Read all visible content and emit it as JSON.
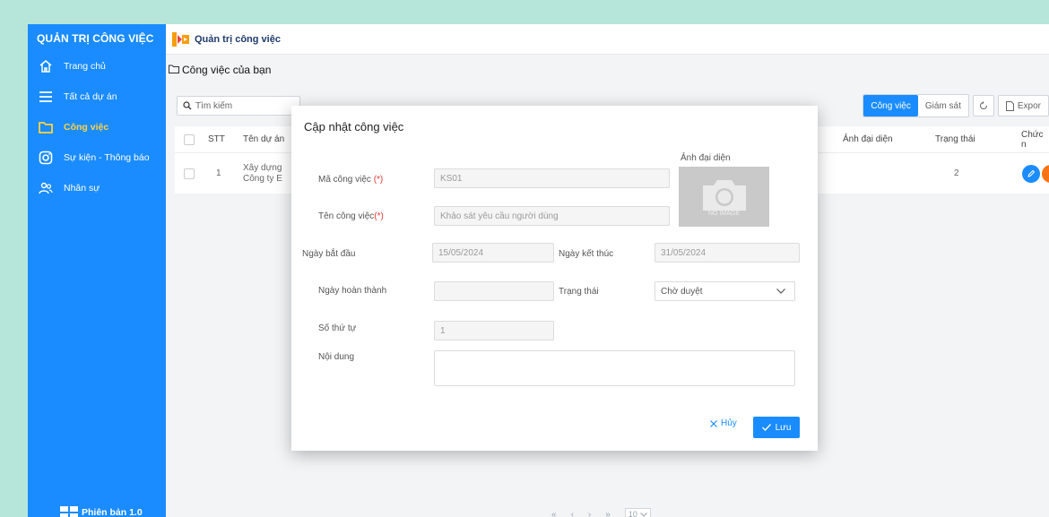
{
  "sidebar": {
    "title": "QUẢN TRỊ CÔNG VIỆC",
    "items": [
      {
        "label": "Trang chủ",
        "icon": "home-icon"
      },
      {
        "label": "Tất cả dự án",
        "icon": "menu-icon"
      },
      {
        "label": "Công việc",
        "icon": "folder-icon",
        "active": true
      },
      {
        "label": "Sự kiện - Thông báo",
        "icon": "instagram-icon"
      },
      {
        "label": "Nhân sự",
        "icon": "users-icon"
      }
    ],
    "version": "Phiên bản 1.0"
  },
  "header": {
    "brand": "Quản trị công việc"
  },
  "page": {
    "title": "Công việc của bạn"
  },
  "search": {
    "placeholder": "Tìm kiếm"
  },
  "toolbar": {
    "tab_work": "Công việc",
    "tab_monitor": "Giám sát",
    "export": "Expor"
  },
  "table": {
    "headers": {
      "stt": "STT",
      "project": "Tên dự án",
      "avatar": "Ảnh đại diện",
      "status": "Trạng thái",
      "actions": "Chức n"
    },
    "rows": [
      {
        "stt": "1",
        "project_line1": "Xây dựng",
        "project_line2": "Công ty E",
        "status": "2"
      }
    ]
  },
  "pager": {
    "first": "«",
    "prev": "‹",
    "next": "›",
    "last": "»",
    "size": "10"
  },
  "modal": {
    "title": "Cập nhật công việc",
    "avatar_label": "Ảnh đại diện",
    "avatar_placeholder": "NO IMAGE",
    "code_label": "Mã công việc",
    "code_req": "(*)",
    "code_value": "KS01",
    "name_label": "Tên công việc",
    "name_req": "(*)",
    "name_value": "Khảo sát yêu cầu người dùng",
    "start_label": "Ngày bắt đầu",
    "start_value": "15/05/2024",
    "end_label": "Ngày kết thúc",
    "end_value": "31/05/2024",
    "done_label": "Ngày hoàn thành",
    "done_value": "",
    "status_label": "Trạng thái",
    "status_value": "Chờ duyệt",
    "order_label": "Số thứ tự",
    "order_value": "1",
    "content_label": "Nội dung",
    "content_value": "",
    "cancel": "Hủy",
    "save": "Lưu"
  },
  "colors": {
    "primary": "#1a8cff",
    "active": "#ffd23f",
    "background": "#b6e6d9"
  }
}
